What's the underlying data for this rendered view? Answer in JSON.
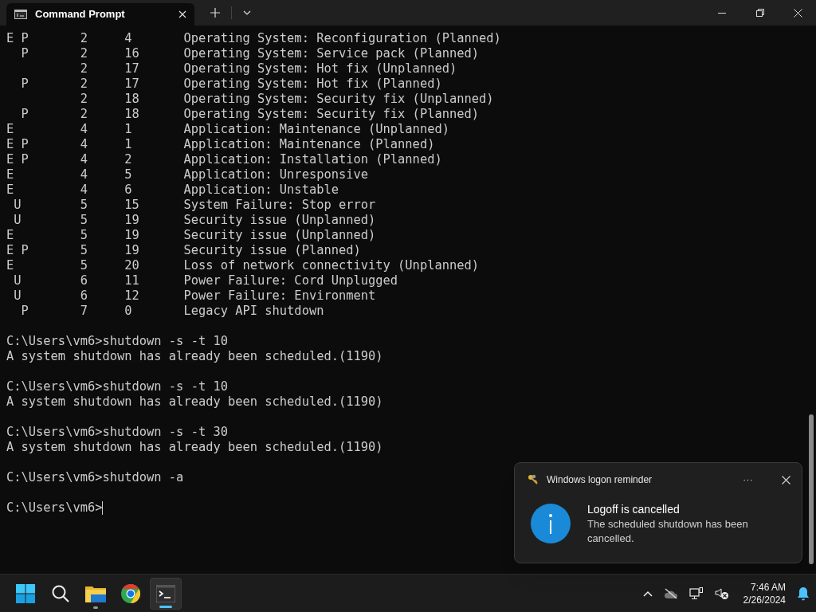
{
  "window": {
    "tab_title": "Command Prompt"
  },
  "terminal": {
    "reason_rows": [
      {
        "flags": "E P",
        "major": "2",
        "minor": "4",
        "reason": "Operating System: Reconfiguration (Planned)"
      },
      {
        "flags": "  P",
        "major": "2",
        "minor": "16",
        "reason": "Operating System: Service pack (Planned)"
      },
      {
        "flags": "",
        "major": "2",
        "minor": "17",
        "reason": "Operating System: Hot fix (Unplanned)"
      },
      {
        "flags": "  P",
        "major": "2",
        "minor": "17",
        "reason": "Operating System: Hot fix (Planned)"
      },
      {
        "flags": "",
        "major": "2",
        "minor": "18",
        "reason": "Operating System: Security fix (Unplanned)"
      },
      {
        "flags": "  P",
        "major": "2",
        "minor": "18",
        "reason": "Operating System: Security fix (Planned)"
      },
      {
        "flags": "E",
        "major": "4",
        "minor": "1",
        "reason": "Application: Maintenance (Unplanned)"
      },
      {
        "flags": "E P",
        "major": "4",
        "minor": "1",
        "reason": "Application: Maintenance (Planned)"
      },
      {
        "flags": "E P",
        "major": "4",
        "minor": "2",
        "reason": "Application: Installation (Planned)"
      },
      {
        "flags": "E",
        "major": "4",
        "minor": "5",
        "reason": "Application: Unresponsive"
      },
      {
        "flags": "E",
        "major": "4",
        "minor": "6",
        "reason": "Application: Unstable"
      },
      {
        "flags": " U",
        "major": "5",
        "minor": "15",
        "reason": "System Failure: Stop error"
      },
      {
        "flags": " U",
        "major": "5",
        "minor": "19",
        "reason": "Security issue (Unplanned)"
      },
      {
        "flags": "E",
        "major": "5",
        "minor": "19",
        "reason": "Security issue (Unplanned)"
      },
      {
        "flags": "E P",
        "major": "5",
        "minor": "19",
        "reason": "Security issue (Planned)"
      },
      {
        "flags": "E",
        "major": "5",
        "minor": "20",
        "reason": "Loss of network connectivity (Unplanned)"
      },
      {
        "flags": " U",
        "major": "6",
        "minor": "11",
        "reason": "Power Failure: Cord Unplugged"
      },
      {
        "flags": " U",
        "major": "6",
        "minor": "12",
        "reason": "Power Failure: Environment"
      },
      {
        "flags": "  P",
        "major": "7",
        "minor": "0",
        "reason": "Legacy API shutdown"
      }
    ],
    "commands": [
      {
        "prompt": "C:\\Users\\vm6>",
        "command": "shutdown -s -t 10",
        "output": "A system shutdown has already been scheduled.(1190)"
      },
      {
        "prompt": "C:\\Users\\vm6>",
        "command": "shutdown -s -t 10",
        "output": "A system shutdown has already been scheduled.(1190)"
      },
      {
        "prompt": "C:\\Users\\vm6>",
        "command": "shutdown -s -t 30",
        "output": "A system shutdown has already been scheduled.(1190)"
      },
      {
        "prompt": "C:\\Users\\vm6>",
        "command": "shutdown -a"
      },
      {
        "prompt": "C:\\Users\\vm6>",
        "cursor": true
      }
    ]
  },
  "notification": {
    "app": "Windows logon reminder",
    "more": "···",
    "title": "Logoff is cancelled",
    "body": "The scheduled shutdown has been cancelled."
  },
  "taskbar": {
    "apps": [
      {
        "kind": "start",
        "selected": false
      },
      {
        "kind": "search",
        "selected": false
      },
      {
        "kind": "explorer",
        "selected": false,
        "running": true
      },
      {
        "kind": "browser",
        "selected": false
      },
      {
        "kind": "terminal",
        "selected": true,
        "running": true
      }
    ],
    "time": "7:46 AM",
    "date": "2/26/2024"
  }
}
